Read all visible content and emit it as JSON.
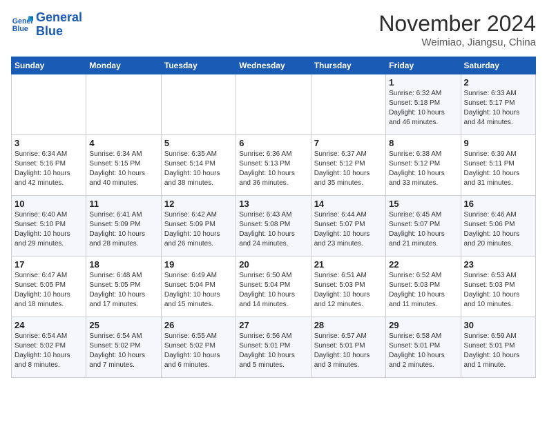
{
  "logo": {
    "line1": "General",
    "line2": "Blue"
  },
  "title": "November 2024",
  "location": "Weimiao, Jiangsu, China",
  "days_of_week": [
    "Sunday",
    "Monday",
    "Tuesday",
    "Wednesday",
    "Thursday",
    "Friday",
    "Saturday"
  ],
  "weeks": [
    [
      {
        "day": "",
        "info": ""
      },
      {
        "day": "",
        "info": ""
      },
      {
        "day": "",
        "info": ""
      },
      {
        "day": "",
        "info": ""
      },
      {
        "day": "",
        "info": ""
      },
      {
        "day": "1",
        "info": "Sunrise: 6:32 AM\nSunset: 5:18 PM\nDaylight: 10 hours\nand 46 minutes."
      },
      {
        "day": "2",
        "info": "Sunrise: 6:33 AM\nSunset: 5:17 PM\nDaylight: 10 hours\nand 44 minutes."
      }
    ],
    [
      {
        "day": "3",
        "info": "Sunrise: 6:34 AM\nSunset: 5:16 PM\nDaylight: 10 hours\nand 42 minutes."
      },
      {
        "day": "4",
        "info": "Sunrise: 6:34 AM\nSunset: 5:15 PM\nDaylight: 10 hours\nand 40 minutes."
      },
      {
        "day": "5",
        "info": "Sunrise: 6:35 AM\nSunset: 5:14 PM\nDaylight: 10 hours\nand 38 minutes."
      },
      {
        "day": "6",
        "info": "Sunrise: 6:36 AM\nSunset: 5:13 PM\nDaylight: 10 hours\nand 36 minutes."
      },
      {
        "day": "7",
        "info": "Sunrise: 6:37 AM\nSunset: 5:12 PM\nDaylight: 10 hours\nand 35 minutes."
      },
      {
        "day": "8",
        "info": "Sunrise: 6:38 AM\nSunset: 5:12 PM\nDaylight: 10 hours\nand 33 minutes."
      },
      {
        "day": "9",
        "info": "Sunrise: 6:39 AM\nSunset: 5:11 PM\nDaylight: 10 hours\nand 31 minutes."
      }
    ],
    [
      {
        "day": "10",
        "info": "Sunrise: 6:40 AM\nSunset: 5:10 PM\nDaylight: 10 hours\nand 29 minutes."
      },
      {
        "day": "11",
        "info": "Sunrise: 6:41 AM\nSunset: 5:09 PM\nDaylight: 10 hours\nand 28 minutes."
      },
      {
        "day": "12",
        "info": "Sunrise: 6:42 AM\nSunset: 5:09 PM\nDaylight: 10 hours\nand 26 minutes."
      },
      {
        "day": "13",
        "info": "Sunrise: 6:43 AM\nSunset: 5:08 PM\nDaylight: 10 hours\nand 24 minutes."
      },
      {
        "day": "14",
        "info": "Sunrise: 6:44 AM\nSunset: 5:07 PM\nDaylight: 10 hours\nand 23 minutes."
      },
      {
        "day": "15",
        "info": "Sunrise: 6:45 AM\nSunset: 5:07 PM\nDaylight: 10 hours\nand 21 minutes."
      },
      {
        "day": "16",
        "info": "Sunrise: 6:46 AM\nSunset: 5:06 PM\nDaylight: 10 hours\nand 20 minutes."
      }
    ],
    [
      {
        "day": "17",
        "info": "Sunrise: 6:47 AM\nSunset: 5:05 PM\nDaylight: 10 hours\nand 18 minutes."
      },
      {
        "day": "18",
        "info": "Sunrise: 6:48 AM\nSunset: 5:05 PM\nDaylight: 10 hours\nand 17 minutes."
      },
      {
        "day": "19",
        "info": "Sunrise: 6:49 AM\nSunset: 5:04 PM\nDaylight: 10 hours\nand 15 minutes."
      },
      {
        "day": "20",
        "info": "Sunrise: 6:50 AM\nSunset: 5:04 PM\nDaylight: 10 hours\nand 14 minutes."
      },
      {
        "day": "21",
        "info": "Sunrise: 6:51 AM\nSunset: 5:03 PM\nDaylight: 10 hours\nand 12 minutes."
      },
      {
        "day": "22",
        "info": "Sunrise: 6:52 AM\nSunset: 5:03 PM\nDaylight: 10 hours\nand 11 minutes."
      },
      {
        "day": "23",
        "info": "Sunrise: 6:53 AM\nSunset: 5:03 PM\nDaylight: 10 hours\nand 10 minutes."
      }
    ],
    [
      {
        "day": "24",
        "info": "Sunrise: 6:54 AM\nSunset: 5:02 PM\nDaylight: 10 hours\nand 8 minutes."
      },
      {
        "day": "25",
        "info": "Sunrise: 6:54 AM\nSunset: 5:02 PM\nDaylight: 10 hours\nand 7 minutes."
      },
      {
        "day": "26",
        "info": "Sunrise: 6:55 AM\nSunset: 5:02 PM\nDaylight: 10 hours\nand 6 minutes."
      },
      {
        "day": "27",
        "info": "Sunrise: 6:56 AM\nSunset: 5:01 PM\nDaylight: 10 hours\nand 5 minutes."
      },
      {
        "day": "28",
        "info": "Sunrise: 6:57 AM\nSunset: 5:01 PM\nDaylight: 10 hours\nand 3 minutes."
      },
      {
        "day": "29",
        "info": "Sunrise: 6:58 AM\nSunset: 5:01 PM\nDaylight: 10 hours\nand 2 minutes."
      },
      {
        "day": "30",
        "info": "Sunrise: 6:59 AM\nSunset: 5:01 PM\nDaylight: 10 hours\nand 1 minute."
      }
    ]
  ]
}
